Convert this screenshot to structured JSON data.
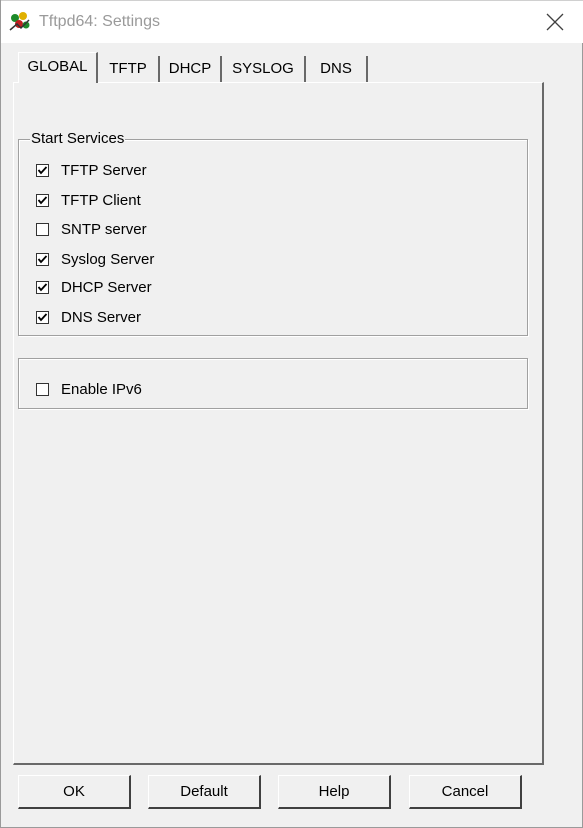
{
  "window": {
    "title": "Tftpd64: Settings",
    "close_icon": "close-icon",
    "app_icon": "tftpd64-app-icon"
  },
  "tabs": [
    {
      "label": "GLOBAL",
      "active": true
    },
    {
      "label": "TFTP",
      "active": false
    },
    {
      "label": "DHCP",
      "active": false
    },
    {
      "label": "SYSLOG",
      "active": false
    },
    {
      "label": "DNS",
      "active": false
    }
  ],
  "start_services": {
    "legend": "Start Services",
    "items": [
      {
        "label": "TFTP Server",
        "checked": true
      },
      {
        "label": "TFTP Client",
        "checked": true
      },
      {
        "label": "SNTP server",
        "checked": false
      },
      {
        "label": "Syslog Server",
        "checked": true
      },
      {
        "label": "DHCP Server",
        "checked": true
      },
      {
        "label": "DNS Server",
        "checked": true
      }
    ]
  },
  "ipv6": {
    "label": "Enable IPv6",
    "checked": false
  },
  "buttons": {
    "ok": "OK",
    "default": "Default",
    "help": "Help",
    "cancel": "Cancel"
  }
}
